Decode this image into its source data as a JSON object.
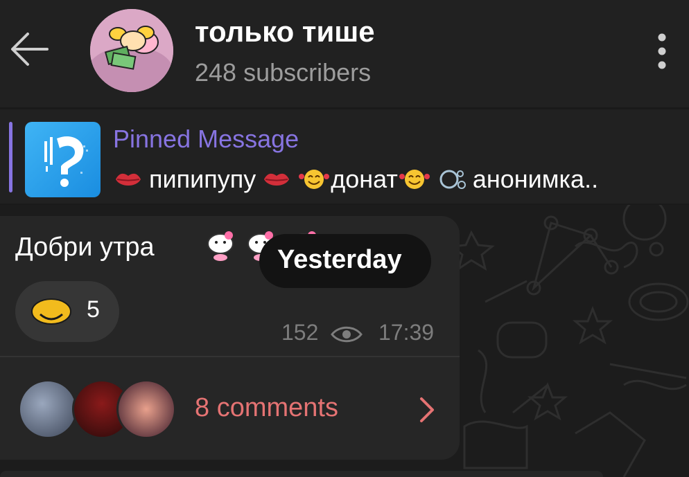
{
  "header": {
    "back_icon": "arrow-left-icon",
    "channel_title": "только тише",
    "subscribers": "248 subscribers",
    "menu_icon": "more-vertical-icon"
  },
  "pinned": {
    "title": "Pinned Message",
    "text_1": "пипипупу",
    "text_2": "донат",
    "text_3": "анонимка..",
    "thumb_icon": "question-mark-icon"
  },
  "message": {
    "text": "Добри утра",
    "reaction_count": "5",
    "views": "152",
    "time": "17:39",
    "comments_label": "8 comments"
  },
  "date_badge": "Yesterday",
  "colors": {
    "accent": "#8774e1",
    "comments": "#e57373",
    "bubble": "#262626",
    "header": "#212121"
  }
}
